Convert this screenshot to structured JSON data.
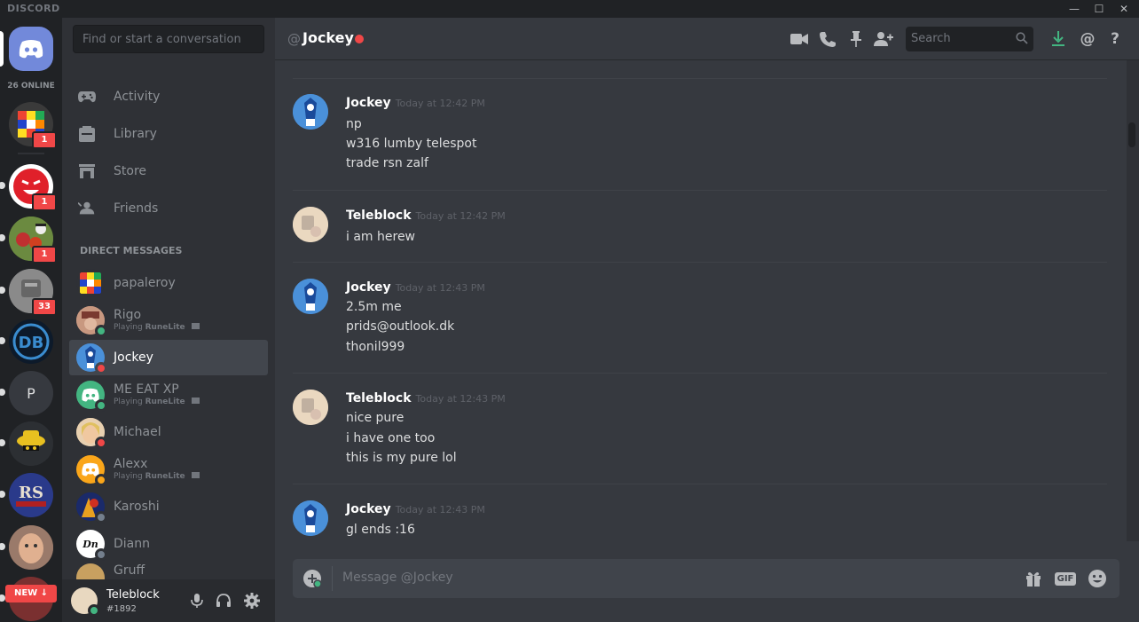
{
  "app": {
    "brand": "DISCORD"
  },
  "window_controls": {
    "minimize": "—",
    "maximize": "☐",
    "close": "✕"
  },
  "guilds": {
    "online_label": "26 ONLINE",
    "badges": [
      "1",
      "1",
      "1",
      "33"
    ],
    "p_server_label": "P",
    "new_button": "NEW ↓"
  },
  "sidebar": {
    "search_placeholder": "Find or start a conversation",
    "nav": [
      {
        "label": "Activity",
        "icon": "gamepad-icon"
      },
      {
        "label": "Library",
        "icon": "library-icon"
      },
      {
        "label": "Store",
        "icon": "store-icon"
      },
      {
        "label": "Friends",
        "icon": "friends-icon"
      }
    ],
    "dm_header": "DIRECT MESSAGES",
    "dms": [
      {
        "name": "papaleroy",
        "sub": "",
        "status": "none"
      },
      {
        "name": "Rigo",
        "sub_prefix": "Playing ",
        "sub_game": "RuneLite",
        "status": "online"
      },
      {
        "name": "Jockey",
        "sub": "",
        "status": "dnd",
        "active": true
      },
      {
        "name": "ME EAT XP",
        "sub_prefix": "Playing ",
        "sub_game": "RuneLite",
        "status": "online"
      },
      {
        "name": "Michael",
        "sub": "",
        "status": "dnd"
      },
      {
        "name": "Alexx",
        "sub_prefix": "Playing ",
        "sub_game": "RuneLite",
        "status": "idle"
      },
      {
        "name": "Karoshi",
        "sub": "",
        "status": "offline"
      },
      {
        "name": "Diann",
        "sub": "",
        "status": "offline"
      },
      {
        "name": "Gruff",
        "sub": "",
        "status": "offline"
      }
    ]
  },
  "user": {
    "name": "Teleblock",
    "tag": "#1892"
  },
  "chat": {
    "at": "@",
    "channel_name": "Jockey",
    "search_placeholder": "Search",
    "message_placeholder": "Message @Jockey",
    "gif_label": "GIF",
    "groups": [
      {
        "author": "Jockey",
        "time": "Today at 12:42 PM",
        "lines": [
          "np",
          "w316 lumby telespot",
          "trade rsn zalf"
        ]
      },
      {
        "author": "Teleblock",
        "time": "Today at 12:42 PM",
        "lines": [
          "i am herew"
        ]
      },
      {
        "author": "Jockey",
        "time": "Today at 12:43 PM",
        "lines": [
          "2.5m me",
          "prids@outlook.dk",
          "thonil999"
        ]
      },
      {
        "author": "Teleblock",
        "time": "Today at 12:43 PM",
        "lines": [
          "nice pure",
          "i have one too",
          "this is my pure lol"
        ]
      },
      {
        "author": "Jockey",
        "time": "Today at 12:43 PM",
        "lines": [
          "gl ends :16"
        ]
      }
    ]
  },
  "colors": {
    "blurple": "#7289da",
    "dnd": "#f04747",
    "online": "#43b581",
    "idle": "#faa61a"
  }
}
